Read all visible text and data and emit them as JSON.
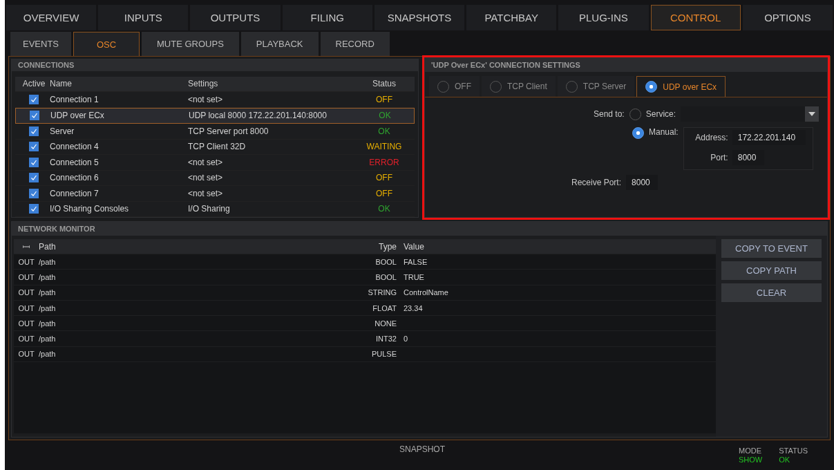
{
  "main_tabs": [
    {
      "label": "OVERVIEW",
      "selected": false
    },
    {
      "label": "INPUTS",
      "selected": false
    },
    {
      "label": "OUTPUTS",
      "selected": false
    },
    {
      "label": "FILING",
      "selected": false
    },
    {
      "label": "SNAPSHOTS",
      "selected": false
    },
    {
      "label": "PATCHBAY",
      "selected": false
    },
    {
      "label": "PLUG-INS",
      "selected": false
    },
    {
      "label": "CONTROL",
      "selected": true
    },
    {
      "label": "OPTIONS",
      "selected": false
    }
  ],
  "sub_tabs": [
    {
      "label": "EVENTS",
      "selected": false
    },
    {
      "label": "OSC",
      "selected": true
    },
    {
      "label": "MUTE GROUPS",
      "selected": false
    },
    {
      "label": "PLAYBACK",
      "selected": false
    },
    {
      "label": "RECORD",
      "selected": false
    }
  ],
  "connections": {
    "title": "CONNECTIONS",
    "columns": [
      "Active",
      "Name",
      "Settings",
      "Status"
    ],
    "rows": [
      {
        "active": true,
        "name": "Connection 1",
        "settings": "<not set>",
        "status": "OFF",
        "color": "#e8b000",
        "selected": false
      },
      {
        "active": true,
        "name": "UDP over ECx",
        "settings": "UDP local 8000 172.22.201.140:8000",
        "status": "OK",
        "color": "#2fa52f",
        "selected": true
      },
      {
        "active": true,
        "name": "Server",
        "settings": "TCP Server port 8000",
        "status": "OK",
        "color": "#2fa52f",
        "selected": false
      },
      {
        "active": true,
        "name": "Connection 4",
        "settings": "TCP Client 32D",
        "status": "WAITING",
        "color": "#e8b000",
        "selected": false
      },
      {
        "active": true,
        "name": "Connection 5",
        "settings": "<not set>",
        "status": "ERROR",
        "color": "#e0202a",
        "selected": false
      },
      {
        "active": true,
        "name": "Connection 6",
        "settings": "<not set>",
        "status": "OFF",
        "color": "#e8b000",
        "selected": false
      },
      {
        "active": true,
        "name": "Connection 7",
        "settings": "<not set>",
        "status": "OFF",
        "color": "#e8b000",
        "selected": false
      },
      {
        "active": true,
        "name": "I/O Sharing Consoles",
        "settings": "I/O Sharing",
        "status": "OK",
        "color": "#2fa52f",
        "selected": false
      }
    ]
  },
  "settings": {
    "title": "'UDP Over ECx' CONNECTION SETTINGS",
    "highlighted": true,
    "modes": [
      {
        "label": "OFF",
        "selected": false
      },
      {
        "label": "TCP Client",
        "selected": false
      },
      {
        "label": "TCP Server",
        "selected": false
      },
      {
        "label": "UDP over ECx",
        "selected": true
      }
    ],
    "send_to_label": "Send to:",
    "service": {
      "label": "Service:",
      "selected": false
    },
    "manual": {
      "label": "Manual:",
      "selected": true
    },
    "address_label": "Address:",
    "address": "172.22.201.140",
    "port_label": "Port:",
    "port": "8000",
    "receive_port_label": "Receive Port:",
    "receive_port": "8000"
  },
  "monitor": {
    "title": "NETWORK MONITOR",
    "columns": [
      "Path",
      "Type",
      "Value"
    ],
    "rows": [
      {
        "direction": "OUT",
        "path": "/path",
        "type": "BOOL",
        "value": "FALSE"
      },
      {
        "direction": "OUT",
        "path": "/path",
        "type": "BOOL",
        "value": "TRUE"
      },
      {
        "direction": "OUT",
        "path": "/path",
        "type": "STRING",
        "value": "ControlName"
      },
      {
        "direction": "OUT",
        "path": "/path",
        "type": "FLOAT",
        "value": "23.34"
      },
      {
        "direction": "OUT",
        "path": "/path",
        "type": "NONE"
      },
      {
        "direction": "OUT",
        "path": "/path",
        "type": "INT32",
        "value": "0"
      },
      {
        "direction": "OUT",
        "path": "/path",
        "type": "PULSE"
      }
    ],
    "buttons": [
      "COPY TO EVENT",
      "COPY PATH",
      "CLEAR"
    ]
  },
  "status_bar": {
    "center": "SNAPSHOT",
    "mode_label": "MODE",
    "mode": "SHOW",
    "status_label": "STATUS",
    "status": "OK"
  }
}
